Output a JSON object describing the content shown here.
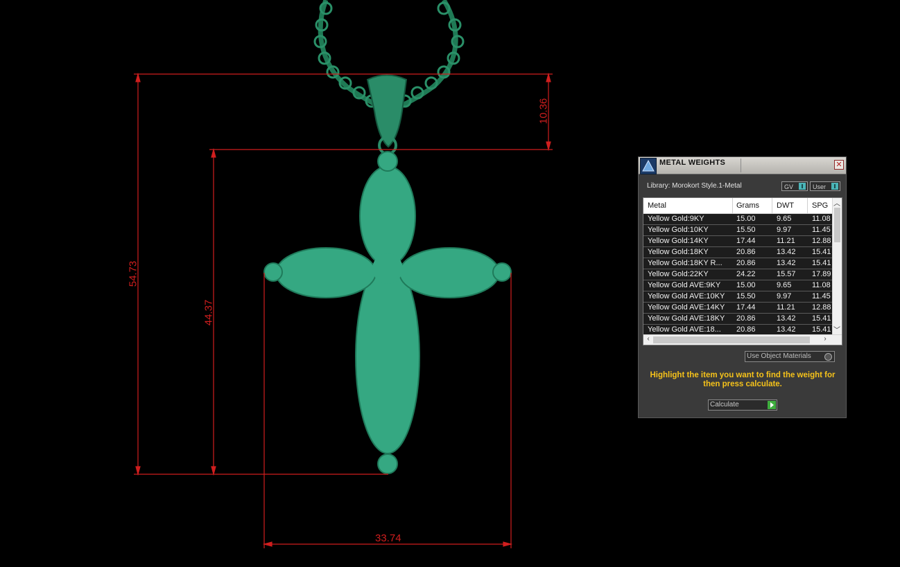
{
  "viewport": {
    "dimensions": [
      "10.36",
      "54.73",
      "44.37",
      "33.74"
    ],
    "colors": {
      "dimension_line": "#d01e1e",
      "pendant": "#35a882",
      "pendant_edge": "#1f7a5a",
      "chain": "#1f7a55"
    }
  },
  "panel": {
    "title": "METAL WEIGHTS",
    "close_icon": "close-icon",
    "library_label": "Library: Morokort Style.1-Metal",
    "gv_chip": "GV",
    "user_chip": "User",
    "columns": [
      "Metal",
      "Grams",
      "DWT",
      "SPG"
    ],
    "rows": [
      [
        "Yellow Gold:9KY",
        "15.00",
        "9.65",
        "11.08"
      ],
      [
        "Yellow Gold:10KY",
        "15.50",
        "9.97",
        "11.45"
      ],
      [
        "Yellow Gold:14KY",
        "17.44",
        "11.21",
        "12.88"
      ],
      [
        "Yellow Gold:18KY",
        "20.86",
        "13.42",
        "15.41"
      ],
      [
        "Yellow Gold:18KY R...",
        "20.86",
        "13.42",
        "15.41"
      ],
      [
        "Yellow Gold:22KY",
        "24.22",
        "15.57",
        "17.89"
      ],
      [
        "Yellow Gold AVE:9KY",
        "15.00",
        "9.65",
        "11.08"
      ],
      [
        "Yellow Gold AVE:10KY",
        "15.50",
        "9.97",
        "11.45"
      ],
      [
        "Yellow Gold AVE:14KY",
        "17.44",
        "11.21",
        "12.88"
      ],
      [
        "Yellow Gold AVE:18KY",
        "20.86",
        "13.42",
        "15.41"
      ],
      [
        "Yellow Gold AVE:18...",
        "20.86",
        "13.42",
        "15.41"
      ]
    ],
    "use_object_materials": "Use Object Materials",
    "hint": "Highlight the item you want to find the weight for then press calculate.",
    "calculate_label": "Calculate",
    "hint_color": "#f5c21a"
  }
}
